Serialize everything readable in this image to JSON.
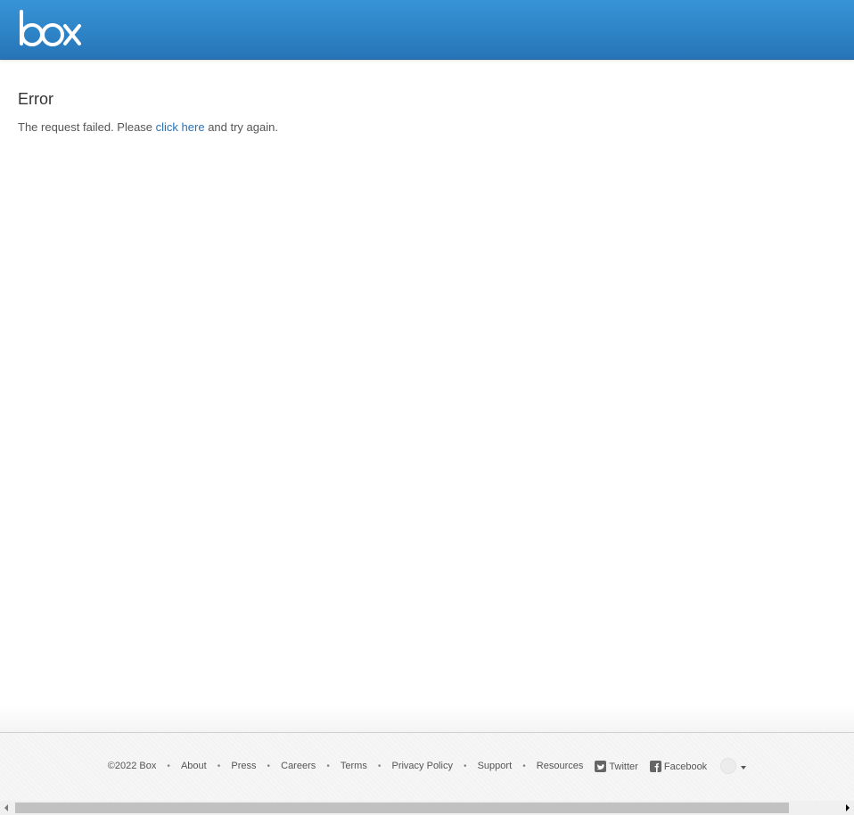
{
  "header": {
    "logo_icon": "box-logo-icon",
    "colors": {
      "top": "#3893d6",
      "bottom": "#2674b7"
    }
  },
  "main": {
    "title": "Error",
    "message_before": "The request failed. Please ",
    "link_text": "click here",
    "message_after": " and try again.",
    "link_color": "#2a72b5"
  },
  "footer": {
    "copyright": "©2022 Box",
    "links": [
      "About",
      "Press",
      "Careers",
      "Terms",
      "Privacy Policy",
      "Support",
      "Resources"
    ],
    "twitter": "Twitter",
    "facebook": "Facebook",
    "language_icon": "globe-icon"
  }
}
